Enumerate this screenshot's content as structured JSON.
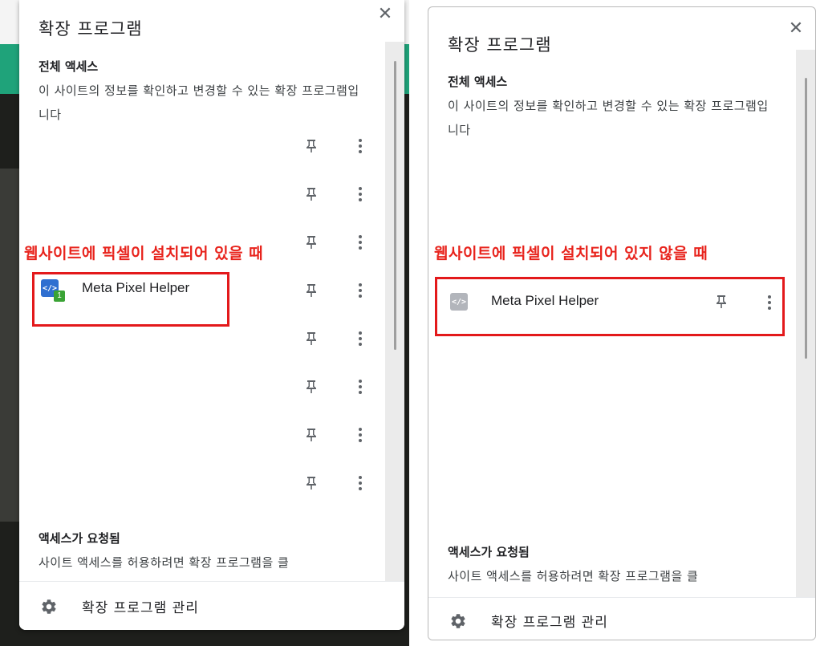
{
  "left_panel": {
    "title": "확장 프로그램",
    "close_label": "✕",
    "full_access_heading": "전체 액세스",
    "full_access_desc": "이 사이트의 정보를 확인하고 변경할 수 있는 확장 프로그램입니다",
    "caption": "웹사이트에 픽셀이 설치되어 있을 때",
    "extension": {
      "name": "Meta Pixel Helper",
      "badge": "1",
      "logo_text": "</>"
    },
    "access_requested_heading": "액세스가 요청됨",
    "access_requested_desc": "사이트 액세스를 허용하려면 확장 프로그램을 클",
    "footer_label": "확장 프로그램 관리"
  },
  "right_panel": {
    "title": "확장 프로그램",
    "close_label": "✕",
    "full_access_heading": "전체 액세스",
    "full_access_desc": "이 사이트의 정보를 확인하고 변경할 수 있는 확장 프로그램입니다",
    "caption": "웹사이트에 픽셀이 설치되어 있지 않을 때",
    "extension": {
      "name": "Meta Pixel Helper",
      "logo_text": "</>"
    },
    "access_requested_heading": "액세스가 요청됨",
    "access_requested_desc": "사이트 액세스를 허용하려면 확장 프로그램을 클",
    "footer_label": "확장 프로그램 관리"
  },
  "colors": {
    "caption_red": "#e8231c",
    "badge_green": "#3aa335",
    "logo_blue": "#2f6fd0",
    "logo_gray": "#b2b5bb"
  },
  "icons": [
    "close-icon",
    "pin-icon",
    "more-vert-icon",
    "gear-icon",
    "meta-pixel-helper-icon"
  ]
}
